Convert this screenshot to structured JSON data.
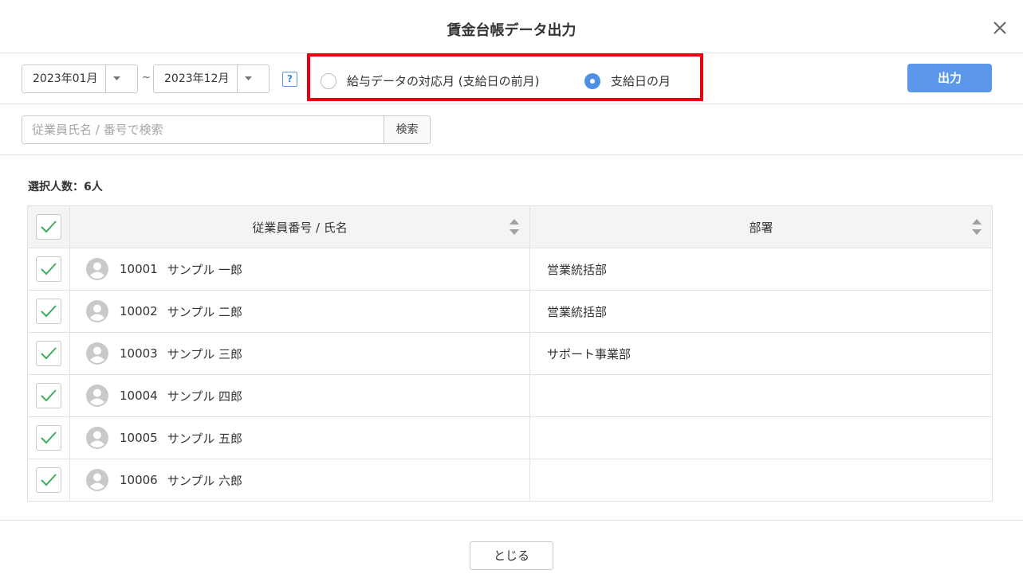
{
  "dialog": {
    "title": "賃金台帳データ出力",
    "close_icon": "close-icon"
  },
  "toolbar": {
    "start_month": "2023年01月",
    "separator": "~",
    "end_month": "2023年12月",
    "help_label": "?",
    "radio_options": [
      {
        "label": "給与データの対応月 (支給日の前月)",
        "selected": false
      },
      {
        "label": "支給日の月",
        "selected": true
      }
    ],
    "output_label": "出力",
    "highlight_color": "#e60012",
    "accent_color": "#5b97ea"
  },
  "search": {
    "placeholder": "従業員氏名 / 番号で検索",
    "button_label": "検索"
  },
  "selection": {
    "count_label": "選択人数：6人"
  },
  "table": {
    "columns": [
      "従業員番号 / 氏名",
      "部署"
    ],
    "header_checked": true,
    "rows": [
      {
        "checked": true,
        "number": "10001",
        "name": "サンプル 一郎",
        "department": "営業統括部"
      },
      {
        "checked": true,
        "number": "10002",
        "name": "サンプル 二郎",
        "department": "営業統括部"
      },
      {
        "checked": true,
        "number": "10003",
        "name": "サンプル 三郎",
        "department": "サポート事業部"
      },
      {
        "checked": true,
        "number": "10004",
        "name": "サンプル 四郎",
        "department": ""
      },
      {
        "checked": true,
        "number": "10005",
        "name": "サンプル 五郎",
        "department": ""
      },
      {
        "checked": true,
        "number": "10006",
        "name": "サンプル 六郎",
        "department": ""
      }
    ]
  },
  "footer": {
    "close_label": "とじる"
  }
}
